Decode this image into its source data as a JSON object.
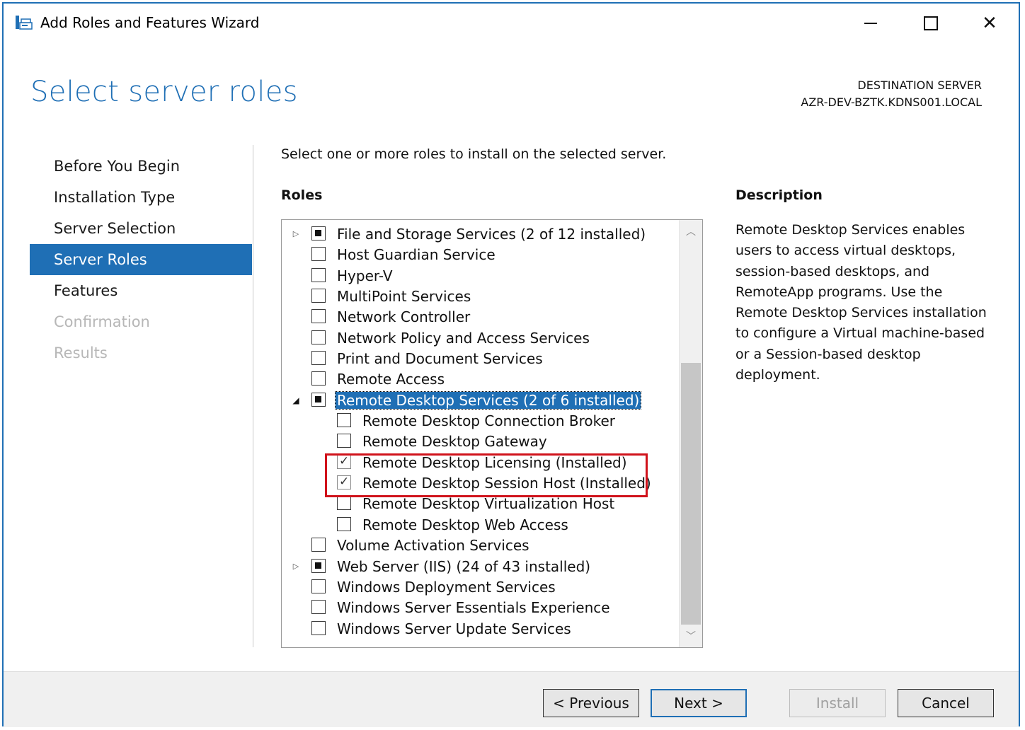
{
  "window": {
    "title": "Add Roles and Features Wizard",
    "icon": "server-manager-icon",
    "controls": {
      "minimize": "minimize-icon",
      "maximize": "maximize-icon",
      "close": "✕"
    }
  },
  "page": {
    "title": "Select server roles",
    "destination_label": "DESTINATION SERVER",
    "destination_server": "AZR-DEV-BZTK.KDNS001.LOCAL"
  },
  "nav": {
    "items": [
      {
        "label": "Before You Begin",
        "state": "normal"
      },
      {
        "label": "Installation Type",
        "state": "normal"
      },
      {
        "label": "Server Selection",
        "state": "normal"
      },
      {
        "label": "Server Roles",
        "state": "active"
      },
      {
        "label": "Features",
        "state": "normal"
      },
      {
        "label": "Confirmation",
        "state": "disabled"
      },
      {
        "label": "Results",
        "state": "disabled"
      }
    ]
  },
  "main": {
    "instruction": "Select one or more roles to install on the selected server.",
    "roles_heading": "Roles",
    "roles": [
      {
        "label": "File and Storage Services (2 of 12 installed)",
        "state": "partial",
        "level": 0,
        "expander": "collapsed"
      },
      {
        "label": "Host Guardian Service",
        "state": "unchecked",
        "level": 0
      },
      {
        "label": "Hyper-V",
        "state": "unchecked",
        "level": 0
      },
      {
        "label": "MultiPoint Services",
        "state": "unchecked",
        "level": 0
      },
      {
        "label": "Network Controller",
        "state": "unchecked",
        "level": 0
      },
      {
        "label": "Network Policy and Access Services",
        "state": "unchecked",
        "level": 0
      },
      {
        "label": "Print and Document Services",
        "state": "unchecked",
        "level": 0
      },
      {
        "label": "Remote Access",
        "state": "unchecked",
        "level": 0
      },
      {
        "label": "Remote Desktop Services (2 of 6 installed)",
        "state": "partial",
        "level": 0,
        "expander": "expanded",
        "selected": true
      },
      {
        "label": "Remote Desktop Connection Broker",
        "state": "unchecked",
        "level": 1
      },
      {
        "label": "Remote Desktop Gateway",
        "state": "unchecked",
        "level": 1
      },
      {
        "label": "Remote Desktop Licensing (Installed)",
        "state": "checked",
        "level": 1
      },
      {
        "label": "Remote Desktop Session Host (Installed)",
        "state": "checked",
        "level": 1
      },
      {
        "label": "Remote Desktop Virtualization Host",
        "state": "unchecked",
        "level": 1
      },
      {
        "label": "Remote Desktop Web Access",
        "state": "unchecked",
        "level": 1
      },
      {
        "label": "Volume Activation Services",
        "state": "unchecked",
        "level": 0
      },
      {
        "label": "Web Server (IIS) (24 of 43 installed)",
        "state": "partial",
        "level": 0,
        "expander": "collapsed"
      },
      {
        "label": "Windows Deployment Services",
        "state": "unchecked",
        "level": 0
      },
      {
        "label": "Windows Server Essentials Experience",
        "state": "unchecked",
        "level": 0
      },
      {
        "label": "Windows Server Update Services",
        "state": "unchecked",
        "level": 0
      }
    ],
    "description_heading": "Description",
    "description": "Remote Desktop Services enables users to access virtual desktops, session-based desktops, and RemoteApp programs. Use the Remote Desktop Services installation to configure a Virtual machine-based or a Session-based desktop deployment.",
    "highlight_color": "#d0121b"
  },
  "footer": {
    "previous": "< Previous",
    "next": "Next >",
    "install": "Install",
    "cancel": "Cancel"
  },
  "colors": {
    "accent": "#1f6fb5",
    "highlight": "#d0121b"
  }
}
